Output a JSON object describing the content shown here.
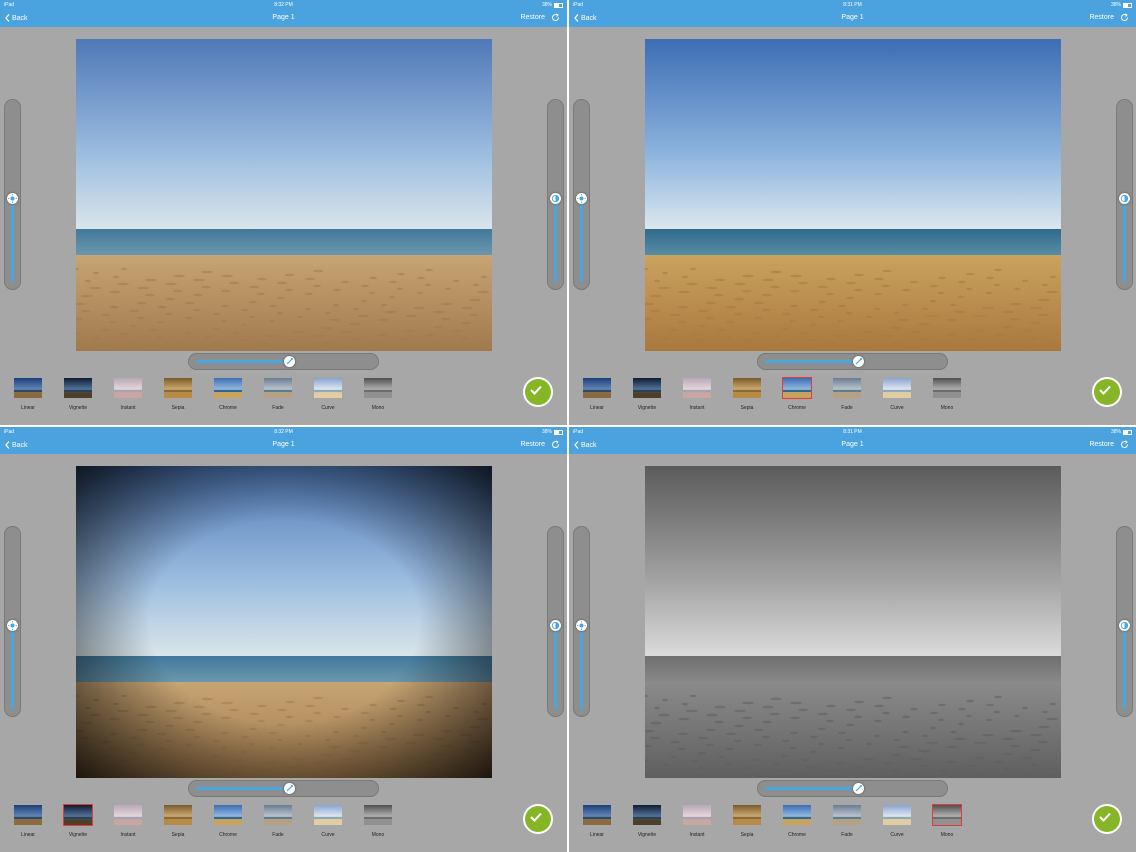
{
  "status_bar": {
    "device": "iPad",
    "wifi": "wifi",
    "battery": "38%"
  },
  "nav": {
    "back_label": "Back",
    "title": "Page 1",
    "restore_label": "Restore"
  },
  "filters": [
    "Linear",
    "Vignette",
    "Instant",
    "Sepia",
    "Chrome",
    "Fade",
    "Curve",
    "Mono"
  ],
  "panels": [
    {
      "time": "8:32 PM",
      "selected_filter": null,
      "photo_style": "original",
      "right_slider_enabled": true,
      "brightness": 0.5,
      "contrast": 0.5,
      "intensity": 0.5
    },
    {
      "time": "8:31 PM",
      "selected_filter": "Chrome",
      "photo_style": "chrome",
      "right_slider_enabled": true,
      "brightness": 0.5,
      "contrast": 0.5,
      "intensity": 0.5
    },
    {
      "time": "8:32 PM",
      "selected_filter": "Vignette",
      "photo_style": "vignette",
      "right_slider_enabled": true,
      "brightness": 0.5,
      "contrast": 0.5,
      "intensity": 0.5
    },
    {
      "time": "8:31 PM",
      "selected_filter": "Mono",
      "photo_style": "mono",
      "right_slider_enabled": true,
      "brightness": 0.5,
      "contrast": 0.5,
      "intensity": 0.5
    }
  ],
  "colors": {
    "nav_bar": "#4aa3de",
    "panel_bg": "#a7a7a7",
    "slider_fill": "#49a6e0",
    "apply_button": "#86b528",
    "selected_border": "#e23b3b"
  },
  "icons": {
    "back": "chevron-left-icon",
    "restore": "refresh-icon",
    "brightness": "sun-icon",
    "contrast": "contrast-icon",
    "intensity": "wand-icon",
    "apply": "checkmark-icon"
  }
}
